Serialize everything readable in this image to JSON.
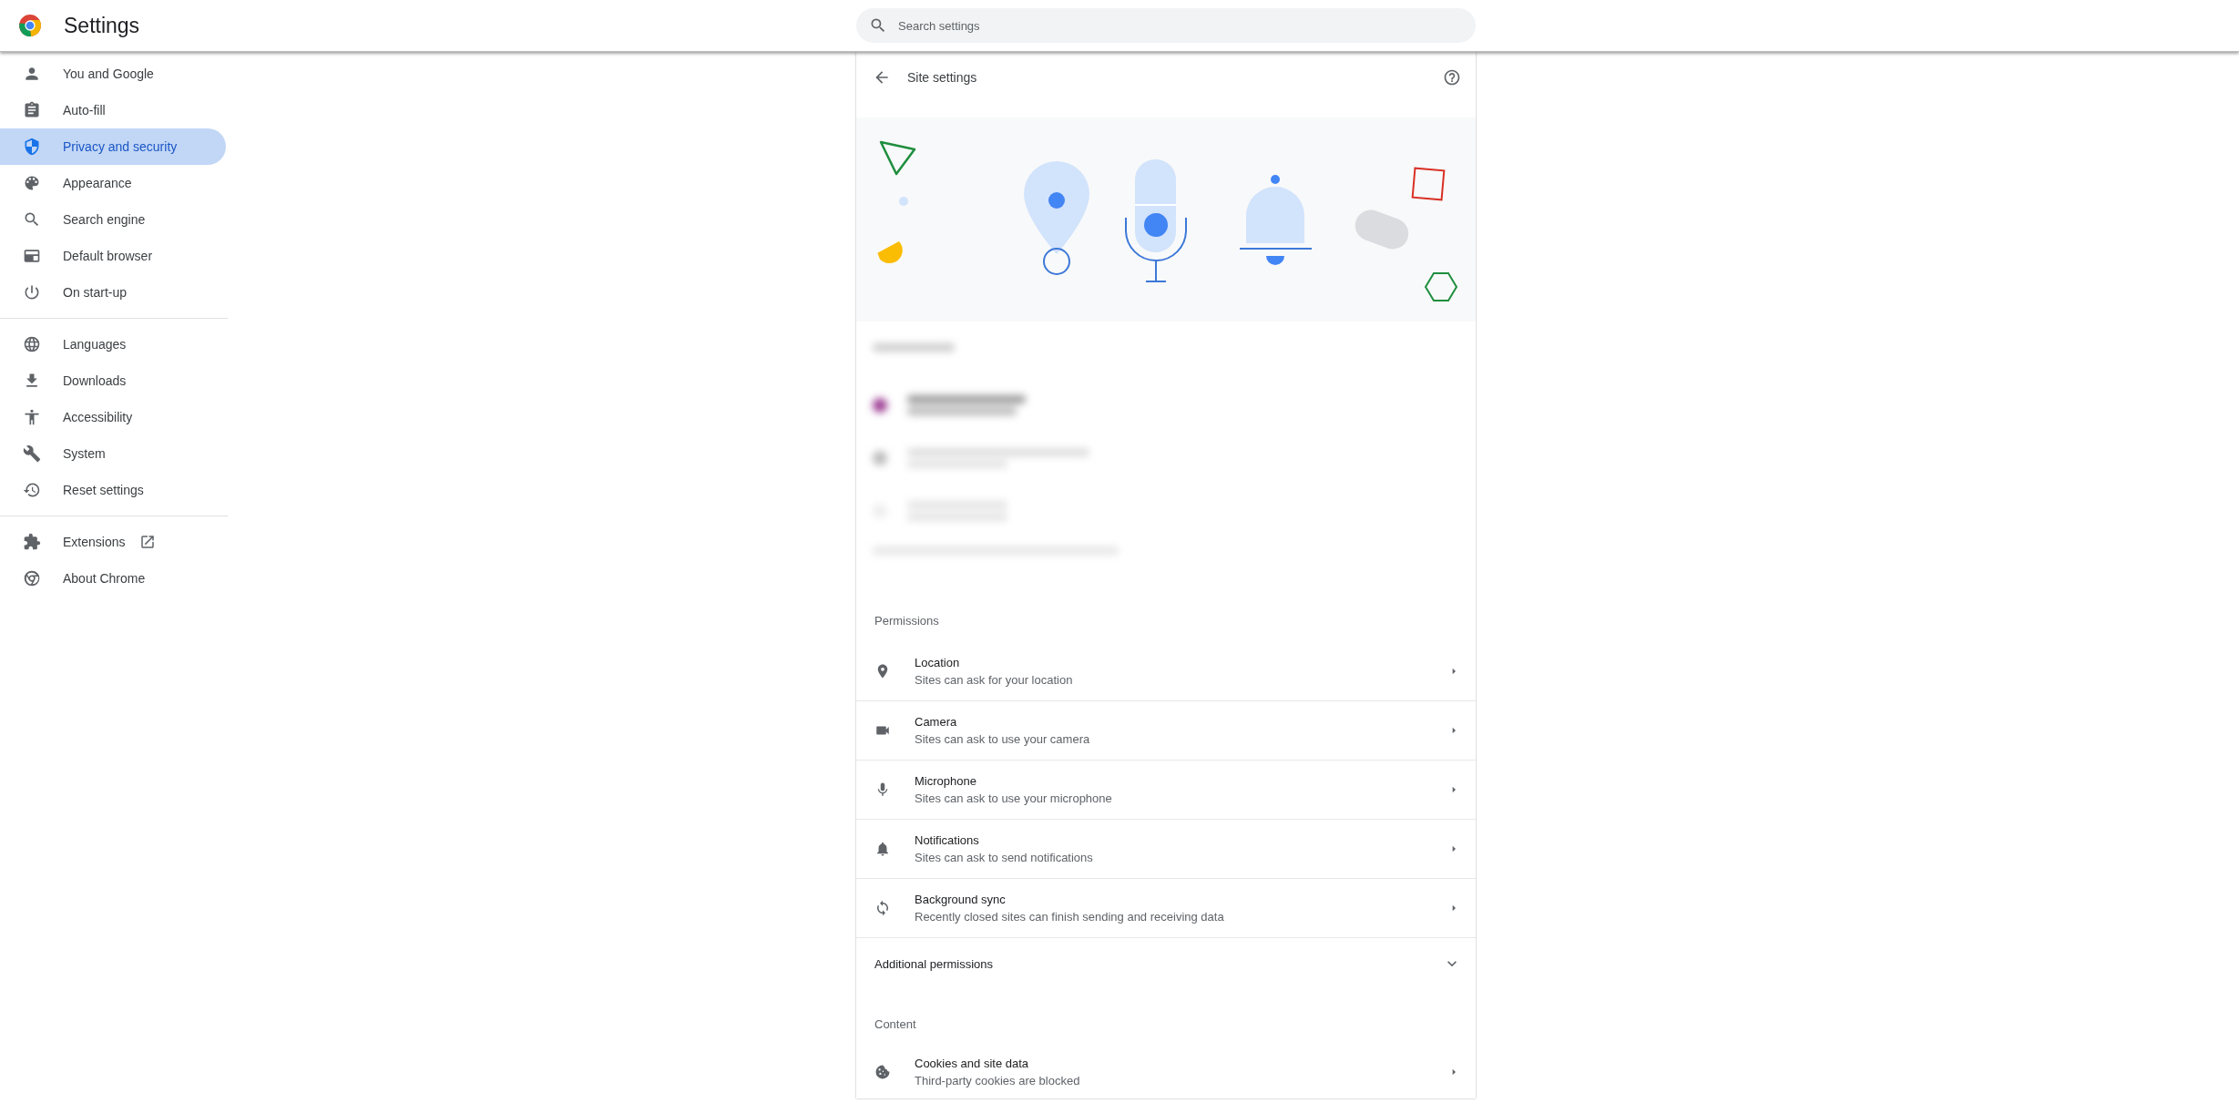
{
  "header": {
    "title": "Settings",
    "search": {
      "placeholder": "Search settings"
    }
  },
  "sidebar": {
    "groups": [
      [
        {
          "label": "You and Google",
          "selected": false,
          "external_link": false
        },
        {
          "label": "Auto-fill",
          "selected": false,
          "external_link": false
        },
        {
          "label": "Privacy and security",
          "selected": true,
          "external_link": false
        },
        {
          "label": "Appearance",
          "selected": false,
          "external_link": false
        },
        {
          "label": "Search engine",
          "selected": false,
          "external_link": false
        },
        {
          "label": "Default browser",
          "selected": false,
          "external_link": false
        },
        {
          "label": "On start-up",
          "selected": false,
          "external_link": false
        }
      ],
      [
        {
          "label": "Languages",
          "selected": false,
          "external_link": false
        },
        {
          "label": "Downloads",
          "selected": false,
          "external_link": false
        },
        {
          "label": "Accessibility",
          "selected": false,
          "external_link": false
        },
        {
          "label": "System",
          "selected": false,
          "external_link": false
        },
        {
          "label": "Reset settings",
          "selected": false,
          "external_link": false
        }
      ],
      [
        {
          "label": "Extensions",
          "selected": false,
          "external_link": true
        },
        {
          "label": "About Chrome",
          "selected": false,
          "external_link": false
        }
      ]
    ]
  },
  "page": {
    "title": "Site settings",
    "permissions": {
      "heading": "Permissions",
      "rows": [
        {
          "title": "Location",
          "subtitle": "Sites can ask for your location"
        },
        {
          "title": "Camera",
          "subtitle": "Sites can ask to use your camera"
        },
        {
          "title": "Microphone",
          "subtitle": "Sites can ask to use your microphone"
        },
        {
          "title": "Notifications",
          "subtitle": "Sites can ask to send notifications"
        },
        {
          "title": "Background sync",
          "subtitle": "Recently closed sites can finish sending and receiving data"
        }
      ],
      "additional": {
        "label": "Additional permissions",
        "expanded": false
      }
    },
    "content": {
      "heading": "Content",
      "rows": [
        {
          "title": "Cookies and site data",
          "subtitle": "Third-party cookies are blocked"
        }
      ]
    }
  }
}
